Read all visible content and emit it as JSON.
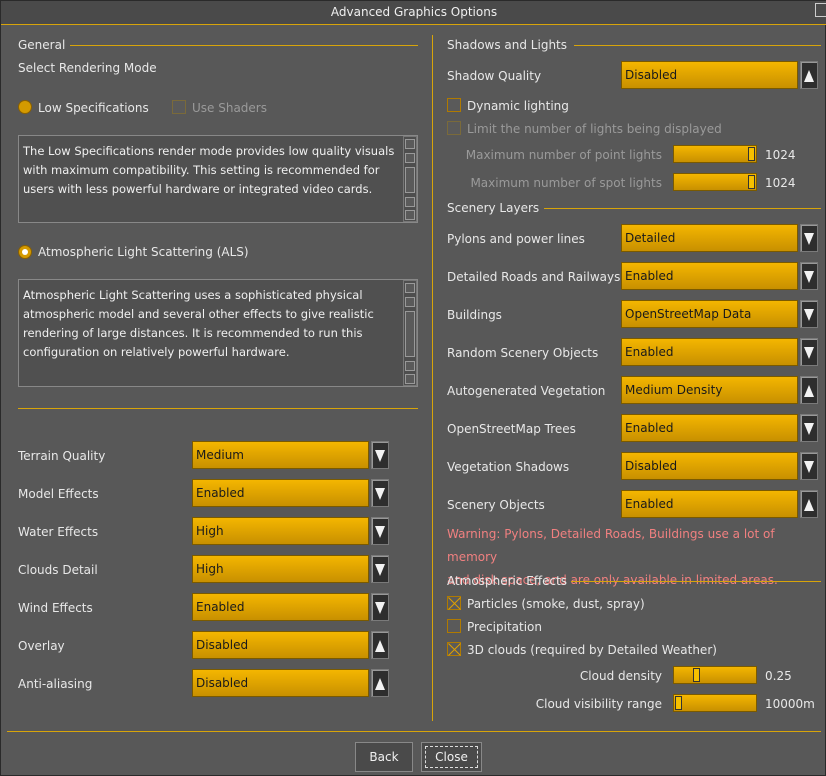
{
  "window": {
    "title": "Advanced Graphics Options"
  },
  "general": {
    "section": "General",
    "rendering_mode_label": "Select Rendering Mode",
    "low_spec_label": "Low Specifications",
    "use_shaders_label": "Use Shaders",
    "low_spec_desc": "The Low Specifications render mode provides low quality visuals with maximum compatibility. This setting is recommended for users with less powerful hardware or integrated video cards.",
    "als_label": "Atmospheric Light Scattering (ALS)",
    "als_desc": "Atmospheric Light Scattering uses a sophisticated physical atmospheric model and several other effects to give realistic rendering of large distances. It is recommended to run this configuration on relatively powerful hardware.",
    "selected_mode": "Atmospheric Light Scattering (ALS)",
    "settings": [
      {
        "label": "Terrain Quality",
        "value": "Medium",
        "arrow": "down"
      },
      {
        "label": "Model Effects",
        "value": "Enabled",
        "arrow": "down"
      },
      {
        "label": "Water Effects",
        "value": "High",
        "arrow": "down"
      },
      {
        "label": "Clouds Detail",
        "value": "High",
        "arrow": "down"
      },
      {
        "label": "Wind Effects",
        "value": "Enabled",
        "arrow": "down"
      },
      {
        "label": "Overlay",
        "value": "Disabled",
        "arrow": "up"
      },
      {
        "label": "Anti-aliasing",
        "value": "Disabled",
        "arrow": "up"
      }
    ]
  },
  "shadows": {
    "section": "Shadows and Lights",
    "quality_label": "Shadow Quality",
    "quality_value": "Disabled",
    "dynamic_label": "Dynamic lighting",
    "dynamic_checked": false,
    "limit_label": "Limit the number of lights being displayed",
    "limit_checked": false,
    "point_label": "Maximum number of point lights",
    "point_value": "1024",
    "point_fraction": 1.0,
    "spot_label": "Maximum number of spot lights",
    "spot_value": "1024",
    "spot_fraction": 1.0
  },
  "scenery": {
    "section": "Scenery Layers",
    "settings": [
      {
        "label": "Pylons and power lines",
        "value": "Detailed",
        "arrow": "down"
      },
      {
        "label": "Detailed Roads and Railways",
        "value": "Enabled",
        "arrow": "down"
      },
      {
        "label": "Buildings",
        "value": "OpenStreetMap Data",
        "arrow": "down"
      },
      {
        "label": "Random Scenery Objects",
        "value": "Enabled",
        "arrow": "down"
      },
      {
        "label": "Autogenerated Vegetation",
        "value": "Medium Density",
        "arrow": "up"
      },
      {
        "label": "OpenStreetMap Trees",
        "value": "Enabled",
        "arrow": "down"
      },
      {
        "label": "Vegetation Shadows",
        "value": "Disabled",
        "arrow": "down"
      },
      {
        "label": "Scenery Objects",
        "value": "Enabled",
        "arrow": "up"
      }
    ],
    "warning_line1": "Warning: Pylons, Detailed Roads, Buildings use a lot of memory",
    "warning_line2": "and disk space, and are only available in limited areas."
  },
  "atmos": {
    "section": "Atmospheric Effects",
    "particles_label": "Particles (smoke, dust, spray)",
    "particles_checked": true,
    "precip_label": "Precipitation",
    "precip_checked": false,
    "clouds3d_label": "3D clouds (required by Detailed Weather)",
    "clouds3d_checked": true,
    "density_label": "Cloud density",
    "density_value": "0.25",
    "density_fraction": 0.25,
    "visibility_label": "Cloud visibility range",
    "visibility_value": "10000m",
    "visibility_fraction": 0.0
  },
  "buttons": {
    "back": "Back",
    "close": "Close"
  },
  "colors": {
    "accent": "#d7a40a",
    "field": "#e8a800",
    "warning": "#f08080",
    "background": "#585858"
  }
}
